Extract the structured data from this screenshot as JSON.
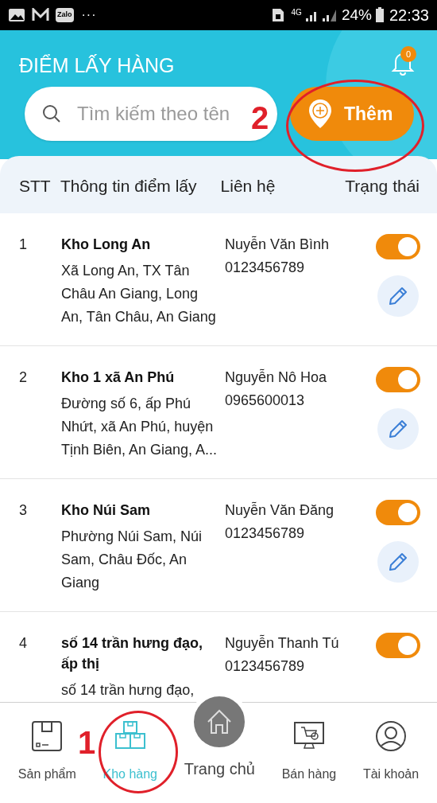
{
  "status_bar": {
    "app_badge": "Zalo",
    "more": "···",
    "network": "4G",
    "battery": "24%",
    "time": "22:33"
  },
  "header": {
    "title": "ĐIỂM LẤY HÀNG",
    "notification_count": "0",
    "search": {
      "placeholder": "Tìm kiếm theo tên"
    },
    "add_button": "Thêm"
  },
  "table": {
    "columns": [
      "STT",
      "Thông tin điểm lấy",
      "Liên hệ",
      "Trạng thái"
    ],
    "rows": [
      {
        "index": "1",
        "name": "Kho Long An",
        "address": "Xã Long An, TX Tân Châu An Giang, Long An, Tân Châu, An Giang",
        "contact_name": "Nuyễn Văn Bình",
        "phone": "0123456789",
        "on": true,
        "editable": true
      },
      {
        "index": "2",
        "name": "Kho 1 xã An Phú",
        "address": "Đường số 6, ấp Phú Nhứt, xã An Phú, huyện Tịnh Biên, An Giang, A...",
        "contact_name": "Nguyễn Nô Hoa",
        "phone": "0965600013",
        "on": true,
        "editable": true
      },
      {
        "index": "3",
        "name": "Kho Núi Sam",
        "address": "Phường Núi Sam, Núi Sam, Châu Đốc, An Giang",
        "contact_name": "Nuyễn Văn Đăng",
        "phone": "0123456789",
        "on": true,
        "editable": true
      },
      {
        "index": "4",
        "name": "số 14 trần hưng đạo, ấp thị",
        "address": "số 14 trần hưng đạo,",
        "contact_name": "Nguyễn Thanh Tú",
        "phone": "0123456789",
        "on": true,
        "editable": false
      }
    ]
  },
  "bottom_nav": [
    {
      "kind": "product",
      "label": "Sản phẩm",
      "selected": false
    },
    {
      "kind": "warehouse",
      "label": "Kho hàng",
      "selected": true
    },
    {
      "kind": "home",
      "label": "Trang chủ",
      "selected": false
    },
    {
      "kind": "sales",
      "label": "Bán hàng",
      "selected": false
    },
    {
      "kind": "account",
      "label": "Tài khoản",
      "selected": false
    }
  ],
  "annotations": [
    {
      "kind": "add",
      "label": "2"
    },
    {
      "kind": "nav",
      "label": "1"
    }
  ]
}
